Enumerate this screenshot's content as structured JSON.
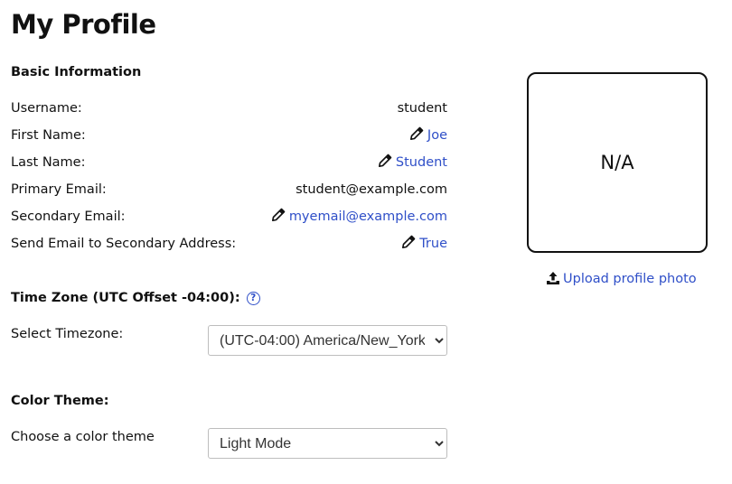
{
  "page": {
    "title": "My Profile"
  },
  "basic_info": {
    "heading": "Basic Information",
    "rows": [
      {
        "label": "Username:",
        "value": "student",
        "editable": false
      },
      {
        "label": "First Name:",
        "value": "Joe",
        "editable": true
      },
      {
        "label": "Last Name:",
        "value": "Student",
        "editable": true
      },
      {
        "label": "Primary Email:",
        "value": "student@example.com",
        "editable": false
      },
      {
        "label": "Secondary Email:",
        "value": "myemail@example.com",
        "editable": true
      },
      {
        "label": "Send Email to Secondary Address:",
        "value": "True",
        "editable": true
      }
    ]
  },
  "timezone": {
    "heading": "Time Zone (UTC Offset -04:00):",
    "help_icon": "question-circle-icon",
    "select_label": "Select Timezone:",
    "selected": "(UTC-04:00) America/New_York"
  },
  "color_theme": {
    "heading": "Color Theme:",
    "select_label": "Choose a color theme",
    "selected": "Light Mode"
  },
  "photo": {
    "placeholder": "N/A",
    "upload_label": "Upload profile photo",
    "upload_icon": "upload-icon"
  },
  "colors": {
    "link": "#2f4fc8",
    "text": "#111111",
    "border": "#bdbdbd"
  }
}
